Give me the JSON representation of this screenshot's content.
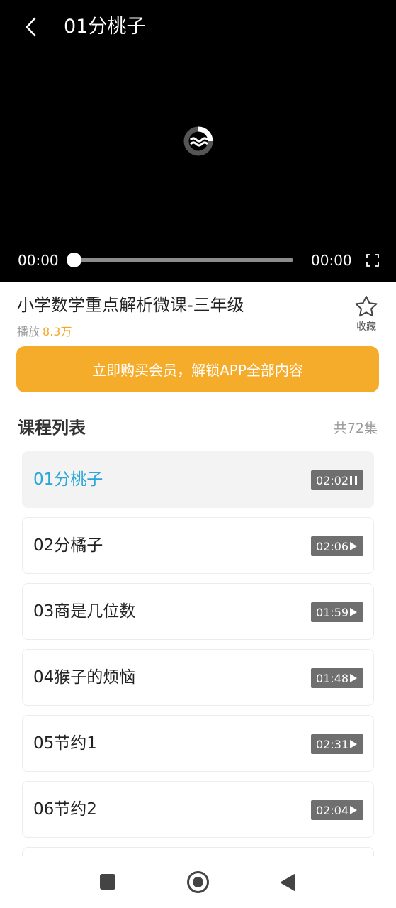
{
  "player": {
    "title": "01分桃子",
    "current_time": "00:00",
    "total_time": "00:00",
    "progress": 0
  },
  "course": {
    "title": "小学数学重点解析微课-三年级",
    "plays_label": "播放",
    "plays_count": "8.3万",
    "favorite_label": "收藏"
  },
  "buy_button": "立即购买会员，解锁APP全部内容",
  "list": {
    "title": "课程列表",
    "count": "共72集",
    "episodes": [
      {
        "name": "01分桃子",
        "duration": "02:02",
        "state": "playing"
      },
      {
        "name": "02分橘子",
        "duration": "02:06",
        "state": "paused"
      },
      {
        "name": "03商是几位数",
        "duration": "01:59",
        "state": "paused"
      },
      {
        "name": "04猴子的烦恼",
        "duration": "01:48",
        "state": "paused"
      },
      {
        "name": "05节约1",
        "duration": "02:31",
        "state": "paused"
      },
      {
        "name": "06节约2",
        "duration": "02:04",
        "state": "paused"
      }
    ]
  },
  "colors": {
    "accent": "#2aa6d8",
    "buy": "#f5ac2b",
    "plays": "#f4a82a"
  },
  "icons": {
    "back": "chevron-left-icon",
    "loading": "loading-icon",
    "fullscreen": "fullscreen-icon",
    "favorite": "star-icon",
    "pause": "pause-icon",
    "play": "play-icon"
  }
}
